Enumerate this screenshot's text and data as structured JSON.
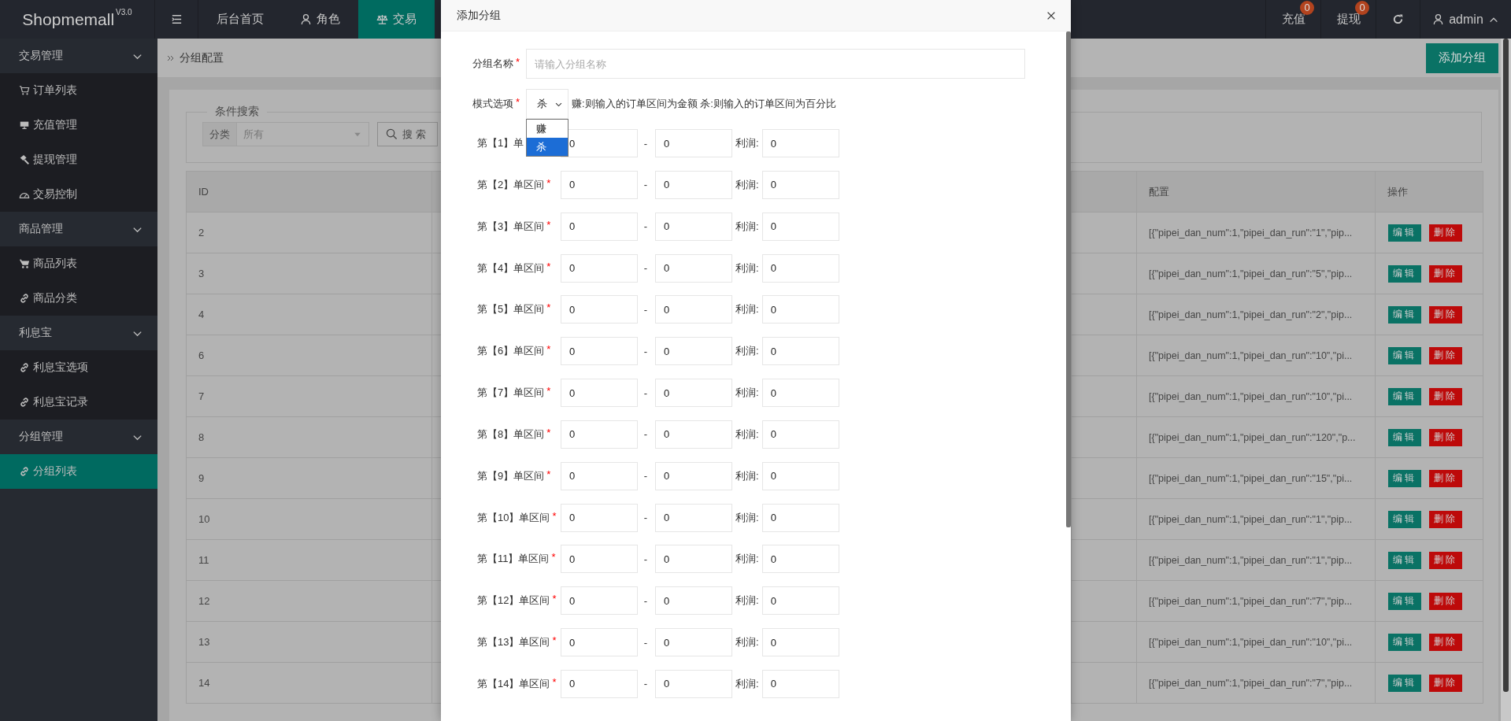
{
  "topbar": {
    "logo": "Shopmemall",
    "version": "V3.0",
    "nav": [
      {
        "label": "后台首页",
        "selected": false
      },
      {
        "label": "角色",
        "selected": false
      },
      {
        "label": "交易",
        "selected": true
      }
    ],
    "counters": [
      {
        "label": "充值",
        "badge": "0"
      },
      {
        "label": "提现",
        "badge": "0"
      }
    ],
    "user": "admin"
  },
  "sidebar": {
    "groups": [
      {
        "label": "交易管理",
        "expanded": true,
        "items": [
          {
            "label": "订单列表",
            "selected": false
          },
          {
            "label": "充值管理",
            "selected": false
          },
          {
            "label": "提现管理",
            "selected": false
          },
          {
            "label": "交易控制",
            "selected": false
          }
        ]
      },
      {
        "label": "商品管理",
        "expanded": true,
        "items": [
          {
            "label": "商品列表",
            "selected": false
          },
          {
            "label": "商品分类",
            "selected": false
          }
        ]
      },
      {
        "label": "利息宝",
        "expanded": true,
        "items": [
          {
            "label": "利息宝选项",
            "selected": false
          },
          {
            "label": "利息宝记录",
            "selected": false
          }
        ]
      },
      {
        "label": "分组管理",
        "expanded": true,
        "items": [
          {
            "label": "分组列表",
            "selected": true
          }
        ]
      }
    ]
  },
  "breadcrumb": "分组配置",
  "add_button": "添加分组",
  "search": {
    "legend": "条件搜索",
    "filter_label": "分类",
    "filter_value": "所有",
    "button": "搜索"
  },
  "table": {
    "columns": [
      {
        "kind": "id",
        "label": "ID"
      },
      {
        "kind": "config",
        "label": "配置"
      },
      {
        "kind": "actions",
        "label": "操作"
      }
    ],
    "rows": [
      {
        "id": "2",
        "config": "[{\"pipei_dan_num\":1,\"pipei_dan_run\":\"1\",\"pip...",
        "edit": "编辑",
        "delete": "删除"
      },
      {
        "id": "3",
        "config": "[{\"pipei_dan_num\":1,\"pipei_dan_run\":\"5\",\"pip...",
        "edit": "编辑",
        "delete": "删除"
      },
      {
        "id": "4",
        "config": "[{\"pipei_dan_num\":1,\"pipei_dan_run\":\"2\",\"pip...",
        "edit": "编辑",
        "delete": "删除"
      },
      {
        "id": "6",
        "config": "[{\"pipei_dan_num\":1,\"pipei_dan_run\":\"10\",\"pi...",
        "edit": "编辑",
        "delete": "删除"
      },
      {
        "id": "7",
        "config": "[{\"pipei_dan_num\":1,\"pipei_dan_run\":\"10\",\"pi...",
        "edit": "编辑",
        "delete": "删除"
      },
      {
        "id": "8",
        "config": "[{\"pipei_dan_num\":1,\"pipei_dan_run\":\"120\",\"p...",
        "edit": "编辑",
        "delete": "删除"
      },
      {
        "id": "9",
        "config": "[{\"pipei_dan_num\":1,\"pipei_dan_run\":\"15\",\"pi...",
        "edit": "编辑",
        "delete": "删除"
      },
      {
        "id": "10",
        "config": "[{\"pipei_dan_num\":1,\"pipei_dan_run\":\"1\",\"pip...",
        "edit": "编辑",
        "delete": "删除"
      },
      {
        "id": "11",
        "config": "[{\"pipei_dan_num\":1,\"pipei_dan_run\":\"1\",\"pip...",
        "edit": "编辑",
        "delete": "删除"
      },
      {
        "id": "12",
        "config": "[{\"pipei_dan_num\":1,\"pipei_dan_run\":\"7\",\"pip...",
        "edit": "编辑",
        "delete": "删除"
      },
      {
        "id": "13",
        "config": "[{\"pipei_dan_num\":1,\"pipei_dan_run\":\"10\",\"pi...",
        "edit": "编辑",
        "delete": "删除"
      },
      {
        "id": "14",
        "config": "[{\"pipei_dan_num\":1,\"pipei_dan_run\":\"7\",\"pip...",
        "edit": "编辑",
        "delete": "删除"
      }
    ]
  },
  "modal": {
    "title": "添加分组",
    "name_field": {
      "label": "分组名称",
      "required_mark": "*",
      "placeholder": "请输入分组名称"
    },
    "mode_field": {
      "label": "模式选项",
      "required_mark": "*",
      "value": "杀",
      "hint": "赚:则输入的订单区间为金额 杀:则输入的订单区间为百分比",
      "expanded": true,
      "options": [
        {
          "label": "赚",
          "selected": false
        },
        {
          "label": "杀",
          "selected": true
        }
      ]
    },
    "ranges": [
      {
        "label": "第【1】单",
        "from": "0",
        "separator": "-",
        "to": "0",
        "profit_label": "利润:",
        "profit": "0"
      },
      {
        "label": "第【2】单区间",
        "required_mark": "*",
        "from": "0",
        "separator": "-",
        "to": "0",
        "profit_label": "利润:",
        "profit": "0"
      },
      {
        "label": "第【3】单区间",
        "required_mark": "*",
        "from": "0",
        "separator": "-",
        "to": "0",
        "profit_label": "利润:",
        "profit": "0"
      },
      {
        "label": "第【4】单区间",
        "required_mark": "*",
        "from": "0",
        "separator": "-",
        "to": "0",
        "profit_label": "利润:",
        "profit": "0"
      },
      {
        "label": "第【5】单区间",
        "required_mark": "*",
        "from": "0",
        "separator": "-",
        "to": "0",
        "profit_label": "利润:",
        "profit": "0"
      },
      {
        "label": "第【6】单区间",
        "required_mark": "*",
        "from": "0",
        "separator": "-",
        "to": "0",
        "profit_label": "利润:",
        "profit": "0"
      },
      {
        "label": "第【7】单区间",
        "required_mark": "*",
        "from": "0",
        "separator": "-",
        "to": "0",
        "profit_label": "利润:",
        "profit": "0"
      },
      {
        "label": "第【8】单区间",
        "required_mark": "*",
        "from": "0",
        "separator": "-",
        "to": "0",
        "profit_label": "利润:",
        "profit": "0"
      },
      {
        "label": "第【9】单区间",
        "required_mark": "*",
        "from": "0",
        "separator": "-",
        "to": "0",
        "profit_label": "利润:",
        "profit": "0"
      },
      {
        "label": "第【10】单区间",
        "required_mark": "*",
        "from": "0",
        "separator": "-",
        "to": "0",
        "profit_label": "利润:",
        "profit": "0"
      },
      {
        "label": "第【11】单区间",
        "required_mark": "*",
        "from": "0",
        "separator": "-",
        "to": "0",
        "profit_label": "利润:",
        "profit": "0"
      },
      {
        "label": "第【12】单区间",
        "required_mark": "*",
        "from": "0",
        "separator": "-",
        "to": "0",
        "profit_label": "利润:",
        "profit": "0"
      },
      {
        "label": "第【13】单区间",
        "required_mark": "*",
        "from": "0",
        "separator": "-",
        "to": "0",
        "profit_label": "利润:",
        "profit": "0"
      },
      {
        "label": "第【14】单区间",
        "required_mark": "*",
        "from": "0",
        "separator": "-",
        "to": "0",
        "profit_label": "利润:",
        "profit": "0"
      }
    ]
  }
}
